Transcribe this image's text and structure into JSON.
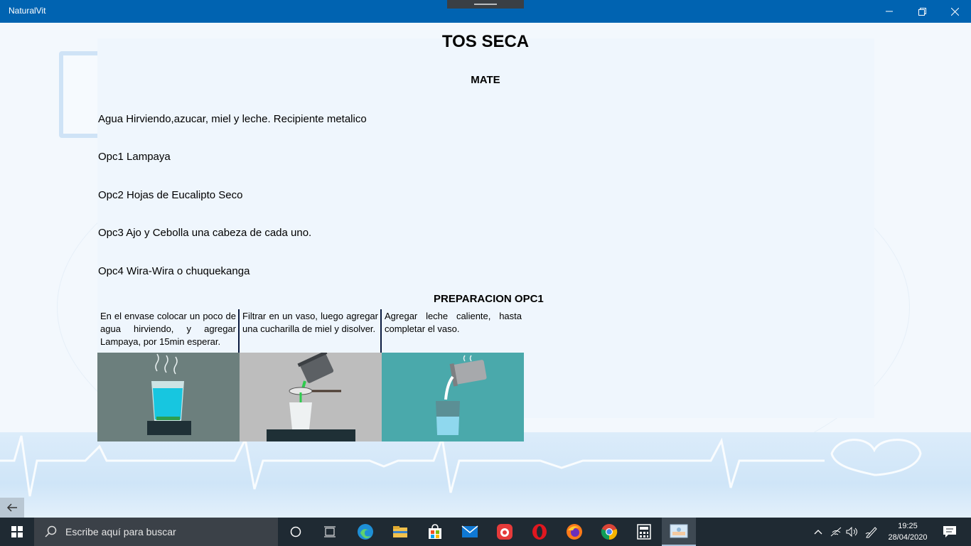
{
  "window": {
    "title": "NaturalVit"
  },
  "page": {
    "title": "TOS SECA",
    "section_title": "MATE",
    "ingredients": [
      "Agua Hirviendo,azucar, miel y leche. Recipiente metalico",
      "Opc1 Lampaya",
      "Opc2 Hojas de Eucalipto Seco",
      "Opc3 Ajo y Cebolla una cabeza de cada uno.",
      "Opc4 Wira-Wira o chuquekanga"
    ],
    "prep_title": "PREPARACION OPC1",
    "steps": [
      "En el envase colocar un poco de agua hirviendo, y agregar Lampaya, por 15min esperar.",
      "Filtrar en un vaso, luego agregar una cucharilla de miel y disolver.",
      "Agregar leche caliente, hasta completar el vaso."
    ],
    "illustrations": [
      "glass-on-stove-illustration",
      "pour-through-strainer-illustration",
      "pour-milk-illustration"
    ]
  },
  "taskbar": {
    "search_placeholder": "Escribe aquí para buscar",
    "apps": [
      "task-view-icon",
      "edge-icon",
      "file-explorer-icon",
      "store-icon",
      "mail-icon",
      "app-red-icon",
      "opera-icon",
      "firefox-icon",
      "chrome-icon",
      "calculator-icon",
      "naturalvit-app-icon"
    ],
    "time": "19:25",
    "date": "28/04/2020"
  },
  "colors": {
    "titlebar": "#0063b1",
    "taskbar": "#1f2a33",
    "panel": "#eff6fd"
  }
}
